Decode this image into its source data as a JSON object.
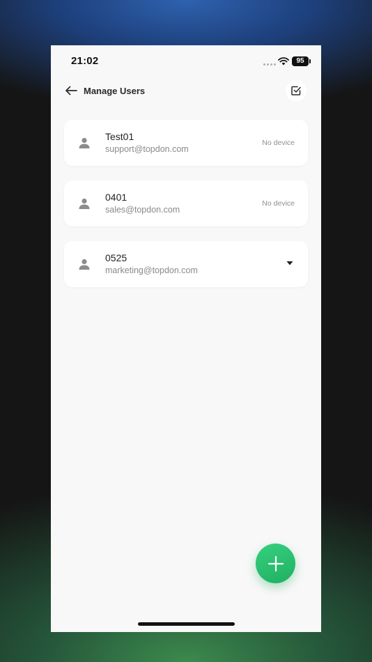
{
  "status_bar": {
    "time": "21:02",
    "battery": "95"
  },
  "header": {
    "title": "Manage Users",
    "icons": {
      "back": "arrow-left-icon",
      "select": "checkbox-icon"
    }
  },
  "users": [
    {
      "name": "Test01",
      "email": "support@topdon.com",
      "device_status": "No device"
    },
    {
      "name": "0401",
      "email": "sales@topdon.com",
      "device_status": "No device"
    },
    {
      "name": "0525",
      "email": "marketing@topdon.com",
      "device_status": ""
    }
  ],
  "fab": {
    "icon": "plus-icon"
  },
  "colors": {
    "accent": "#2ac271",
    "background": "#f8f8f8",
    "card": "#ffffff",
    "muted_text": "#8a8a8a"
  }
}
